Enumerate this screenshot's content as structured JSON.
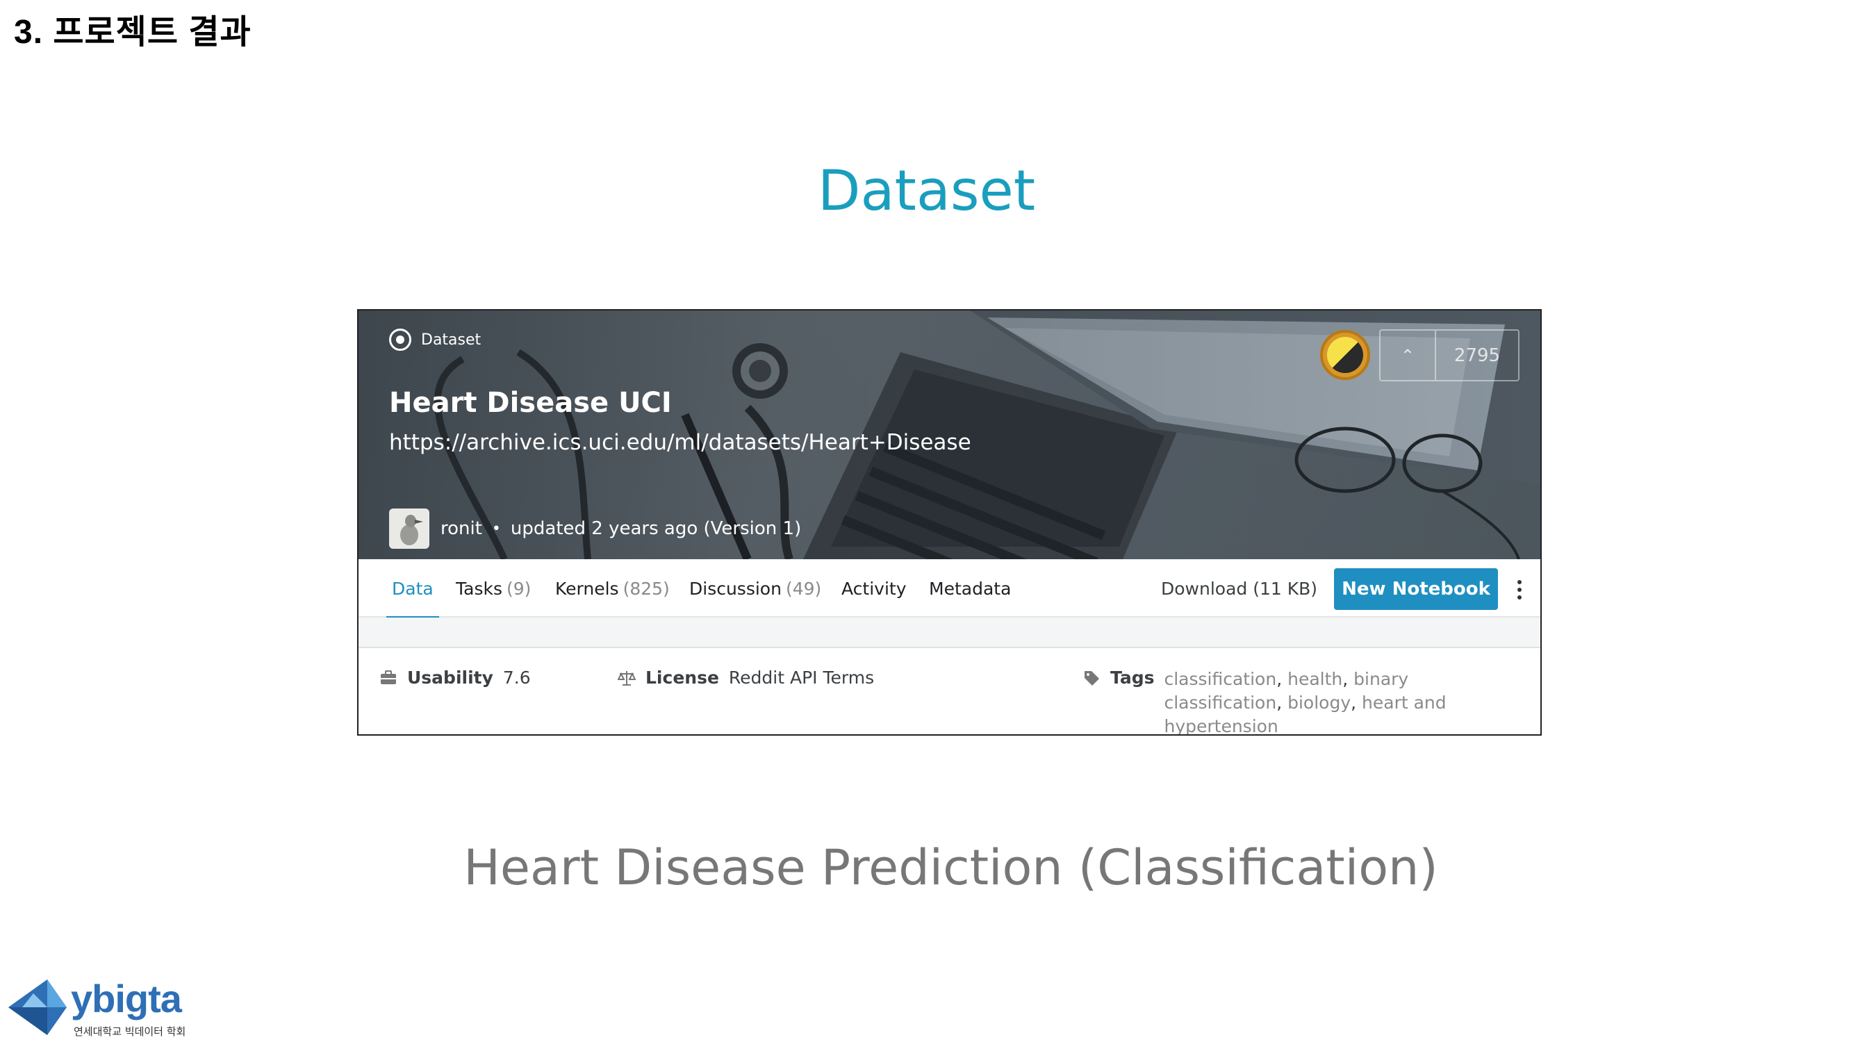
{
  "slide": {
    "section_title": "3. 프로젝트 결과",
    "main_title": "Dataset",
    "subtitle": "Heart Disease Prediction (Classification)"
  },
  "dataset": {
    "badge": "Dataset",
    "title": "Heart Disease UCI",
    "url": "https://archive.ics.uci.edu/ml/datasets/Heart+Disease",
    "owner": "ronit",
    "separator": "•",
    "updated": "updated 2 years ago (Version 1)",
    "upvotes": "2795"
  },
  "tabs": [
    {
      "label": "Data",
      "count": ""
    },
    {
      "label": "Tasks",
      "count": "(9)"
    },
    {
      "label": "Kernels",
      "count": "(825)"
    },
    {
      "label": "Discussion",
      "count": "(49)"
    },
    {
      "label": "Activity",
      "count": ""
    },
    {
      "label": "Metadata",
      "count": ""
    }
  ],
  "actions": {
    "download": "Download (11 KB)",
    "new_notebook": "New Notebook"
  },
  "meta": {
    "usability_label": "Usability",
    "usability_value": "7.6",
    "license_label": "License",
    "license_value": "Reddit API Terms",
    "tags_label": "Tags",
    "tags": [
      "classification",
      "health",
      "binary classification",
      "biology",
      "heart and hypertension"
    ]
  },
  "logo": {
    "name": "ybigta",
    "caption": "연세대학교 빅데이터 학회"
  },
  "colors": {
    "title_blue": "#1a9ebe",
    "kaggle_blue": "#1f8fc1",
    "subtitle_gray": "#777777"
  }
}
